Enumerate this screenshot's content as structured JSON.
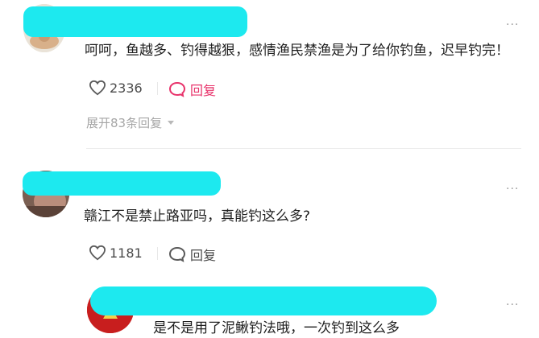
{
  "colors": {
    "highlight_reply": "#e8336b",
    "redaction": "#1de9ef",
    "text": "#1f1f1f",
    "muted": "#a6a6a6"
  },
  "comments": [
    {
      "text": "呵呵，鱼越多、钓得越狠，感情渔民禁渔是为了给你钓鱼，迟早钓完！",
      "likes": "2336",
      "reply_label": "回复",
      "expand_label": "展开83条回复",
      "more": "···"
    },
    {
      "text": "赣江不是禁止路亚吗，真能钓这么多?",
      "likes": "1181",
      "reply_label": "回复",
      "more": "···"
    }
  ],
  "nested_reply": {
    "text": "是不是用了泥鳅钓法哦，一次钓到这么多",
    "more": "···"
  }
}
